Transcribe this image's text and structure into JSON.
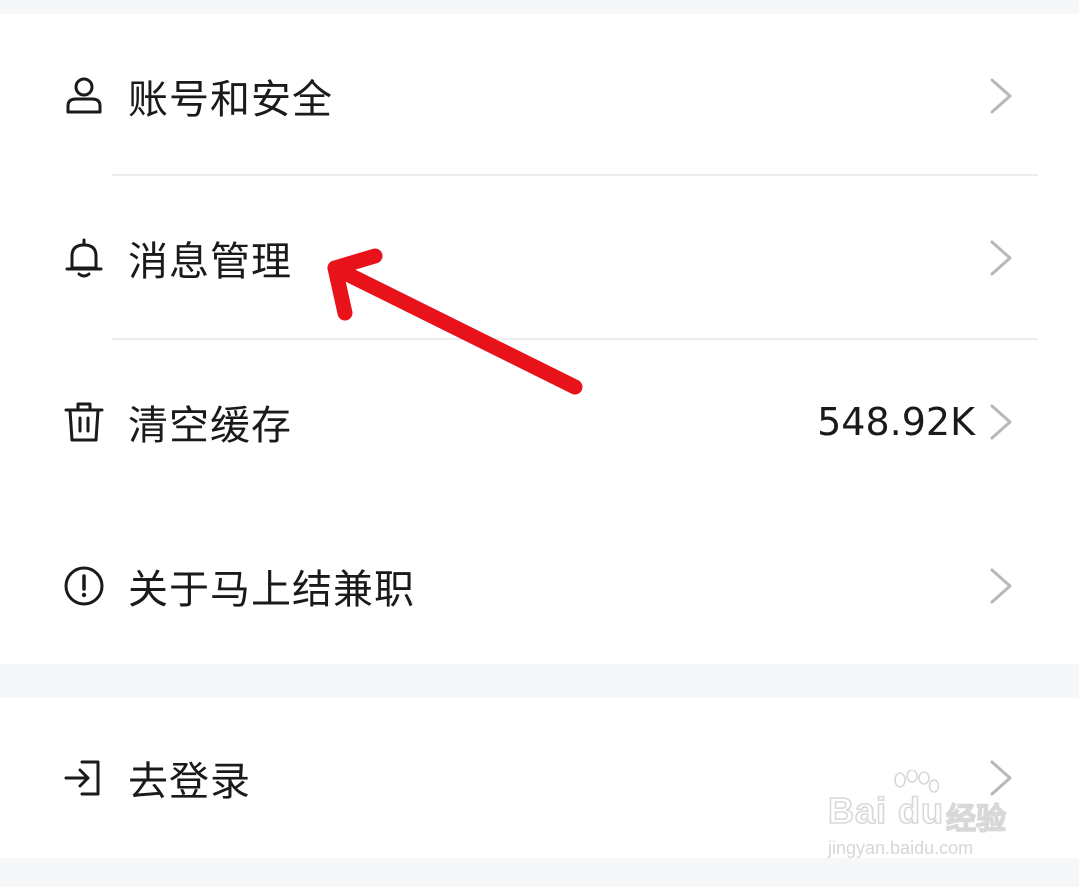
{
  "settings": {
    "items": [
      {
        "label": "账号和安全",
        "icon": "user-icon"
      },
      {
        "label": "消息管理",
        "icon": "bell-icon"
      },
      {
        "label": "清空缓存",
        "icon": "trash-icon",
        "value": "548.92K"
      },
      {
        "label": "关于马上结兼职",
        "icon": "info-icon"
      }
    ],
    "login": {
      "label": "去登录",
      "icon": "login-icon"
    }
  },
  "annotation": {
    "arrow_color": "#e8121b",
    "points_to": "消息管理"
  },
  "watermark": {
    "brand": "Bai du",
    "text": "经验",
    "url": "jingyan.baidu.com"
  },
  "colors": {
    "background": "#f5f7f8",
    "card": "#ffffff",
    "text": "#1a1a1a",
    "chevron": "#b8b8b8",
    "divider": "#ececec"
  }
}
